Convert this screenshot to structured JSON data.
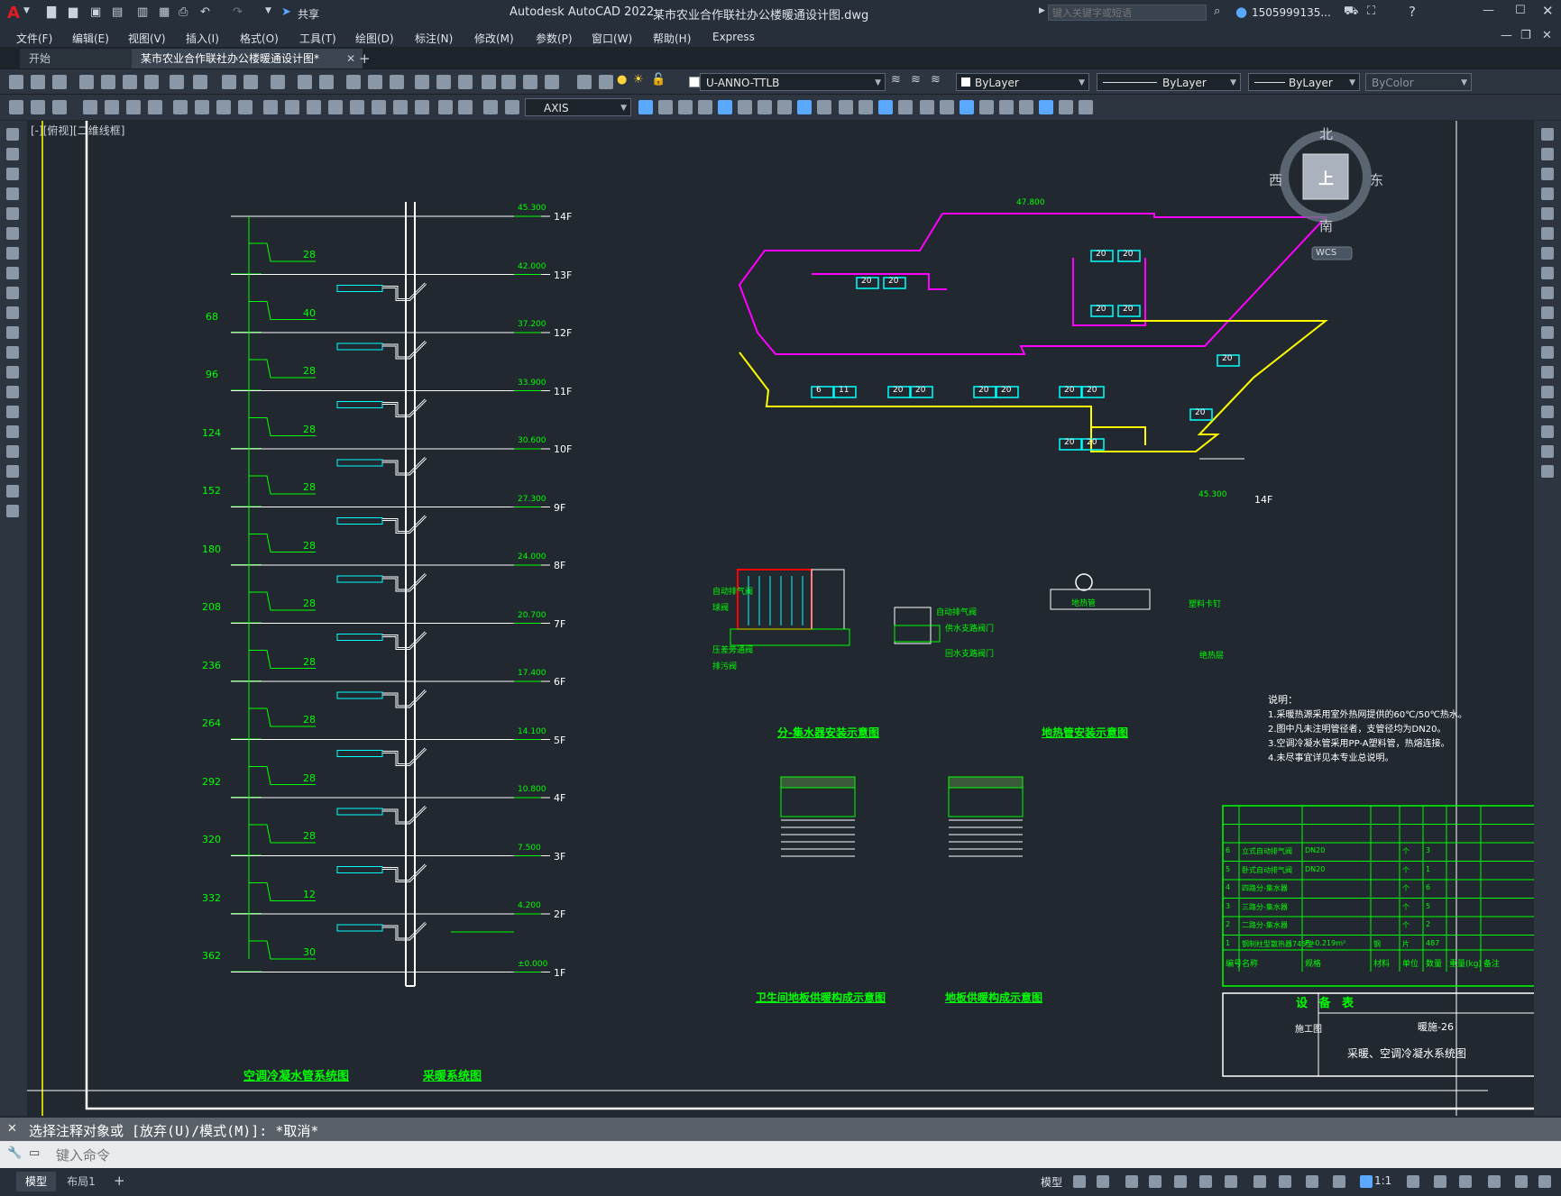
{
  "app": {
    "title": "Autodesk AutoCAD 2022",
    "filename": "某市农业合作联社办公楼暖通设计图.dwg",
    "logo": "A",
    "share_label": "共享",
    "search_placeholder": "键入关键字或短语",
    "user": "1505999135...",
    "colors": {
      "accent": "#e51b24",
      "magenta": "#ff00ff",
      "green": "#00ff00",
      "yellow": "#ffff00",
      "cyan": "#00ffff",
      "red": "#ff0000"
    }
  },
  "menu": [
    "文件(F)",
    "编辑(E)",
    "视图(V)",
    "插入(I)",
    "格式(O)",
    "工具(T)",
    "绘图(D)",
    "标注(N)",
    "修改(M)",
    "参数(P)",
    "窗口(W)",
    "帮助(H)",
    "Express"
  ],
  "tabs": [
    {
      "label": "开始",
      "active": false
    },
    {
      "label": "某市农业合作联社办公楼暖通设计图*",
      "active": true
    }
  ],
  "toolbar": {
    "layer": "U-ANNO-TTLB",
    "color": "ByLayer",
    "linetype": "ByLayer",
    "lineweight": "ByLayer",
    "plotstyle": "ByColor",
    "textstyle": "AXIS"
  },
  "viewport_label": "[-][俯视][二维线框]",
  "viewcube": {
    "north": "北",
    "south": "南",
    "east": "东",
    "west": "西",
    "top": "上",
    "wcs": "WCS"
  },
  "drawing": {
    "left_title": "空调冷凝水管系统图",
    "right_title": "采暖系统图",
    "floors": [
      {
        "label": "14F",
        "elev": "45.300",
        "count": "",
        "room": "28",
        "num": ""
      },
      {
        "label": "13F",
        "elev": "42.000",
        "count": "68",
        "room": "40",
        "num": ""
      },
      {
        "label": "12F",
        "elev": "37.200",
        "count": "96",
        "room": "28",
        "num": ""
      },
      {
        "label": "11F",
        "elev": "33.900",
        "count": "124",
        "room": "28",
        "num": ""
      },
      {
        "label": "10F",
        "elev": "30.600",
        "count": "152",
        "room": "28",
        "num": ""
      },
      {
        "label": "9F",
        "elev": "27.300",
        "count": "180",
        "room": "28",
        "num": ""
      },
      {
        "label": "8F",
        "elev": "24.000",
        "count": "208",
        "room": "28",
        "num": ""
      },
      {
        "label": "7F",
        "elev": "20.700",
        "count": "236",
        "room": "28",
        "num": ""
      },
      {
        "label": "6F",
        "elev": "17.400",
        "count": "264",
        "room": "28",
        "num": ""
      },
      {
        "label": "5F",
        "elev": "14.100",
        "count": "292",
        "room": "28",
        "num": ""
      },
      {
        "label": "4F",
        "elev": "10.800",
        "count": "320",
        "room": "28",
        "num": ""
      },
      {
        "label": "3F",
        "elev": "7.500",
        "count": "332",
        "room": "12",
        "num": ""
      },
      {
        "label": "2F",
        "elev": "4.200",
        "count": "362",
        "room": "30",
        "num": ""
      },
      {
        "label": "1F",
        "elev": "±0.000",
        "count": "",
        "room": "",
        "num": ""
      }
    ],
    "plan_label": "14F",
    "plan_elev": "45.300",
    "plan_elev_top": "47.800",
    "radiators": [
      "20",
      "20",
      "20",
      "20",
      "20",
      "20",
      "6",
      "11",
      "20",
      "20",
      "20",
      "20",
      "20",
      "20",
      "20",
      "20",
      "20",
      "20"
    ],
    "detail_titles": [
      "分-集水器安装示意图",
      "地热管安装示意图",
      "卫生间地板供暖构成示意图",
      "地板供暖构成示意图"
    ],
    "detail_labels": [
      "自动排气阀",
      "球阀",
      "压差旁通阀",
      "排污阀",
      "自动排气阀",
      "供水支路阀门",
      "回水支路阀门",
      "地热管",
      "塑料卡钉",
      "绝热层"
    ],
    "notes_title": "说明：",
    "notes": [
      "1.采暖热源采用室外热网提供的60℃/50℃热水。",
      "2.图中凡未注明管径者，支管径均为DN20。",
      "3.空调冷凝水管采用PP-A塑料管，热熔连接。",
      "4.未尽事宜详见本专业总说明。"
    ],
    "equipment": {
      "title": "设 备 表",
      "headers": [
        "编号",
        "名称",
        "规格",
        "材料",
        "单位",
        "数量",
        "重量(kg)",
        "备注"
      ],
      "rows": [
        [
          "6",
          "立式自动排气阀",
          "DN20",
          "",
          "个",
          "3",
          "",
          ""
        ],
        [
          "5",
          "卧式自动排气阀",
          "DN20",
          "",
          "个",
          "1",
          "",
          ""
        ],
        [
          "4",
          "四路分-集水器",
          "",
          "",
          "个",
          "6",
          "",
          ""
        ],
        [
          "3",
          "三路分-集水器",
          "",
          "",
          "个",
          "5",
          "",
          ""
        ],
        [
          "2",
          "二路分-集水器",
          "",
          "",
          "个",
          "2",
          "",
          ""
        ],
        [
          "1",
          "钢制柱型散热器745型",
          "F=0.219m²",
          "钢",
          "片",
          "487",
          "",
          ""
        ]
      ]
    },
    "titleblock": {
      "stage": "施工图",
      "drawing_no": "暖施-26",
      "drawing_title": "采暖、空调冷凝水系统图"
    }
  },
  "command": {
    "history": "选择注释对象或 [放弃(U)/模式(M)]: *取消*",
    "placeholder": "键入命令"
  },
  "status": {
    "layout_tabs": [
      "模型",
      "布局1"
    ],
    "model_label": "模型",
    "scale": "1:1"
  }
}
